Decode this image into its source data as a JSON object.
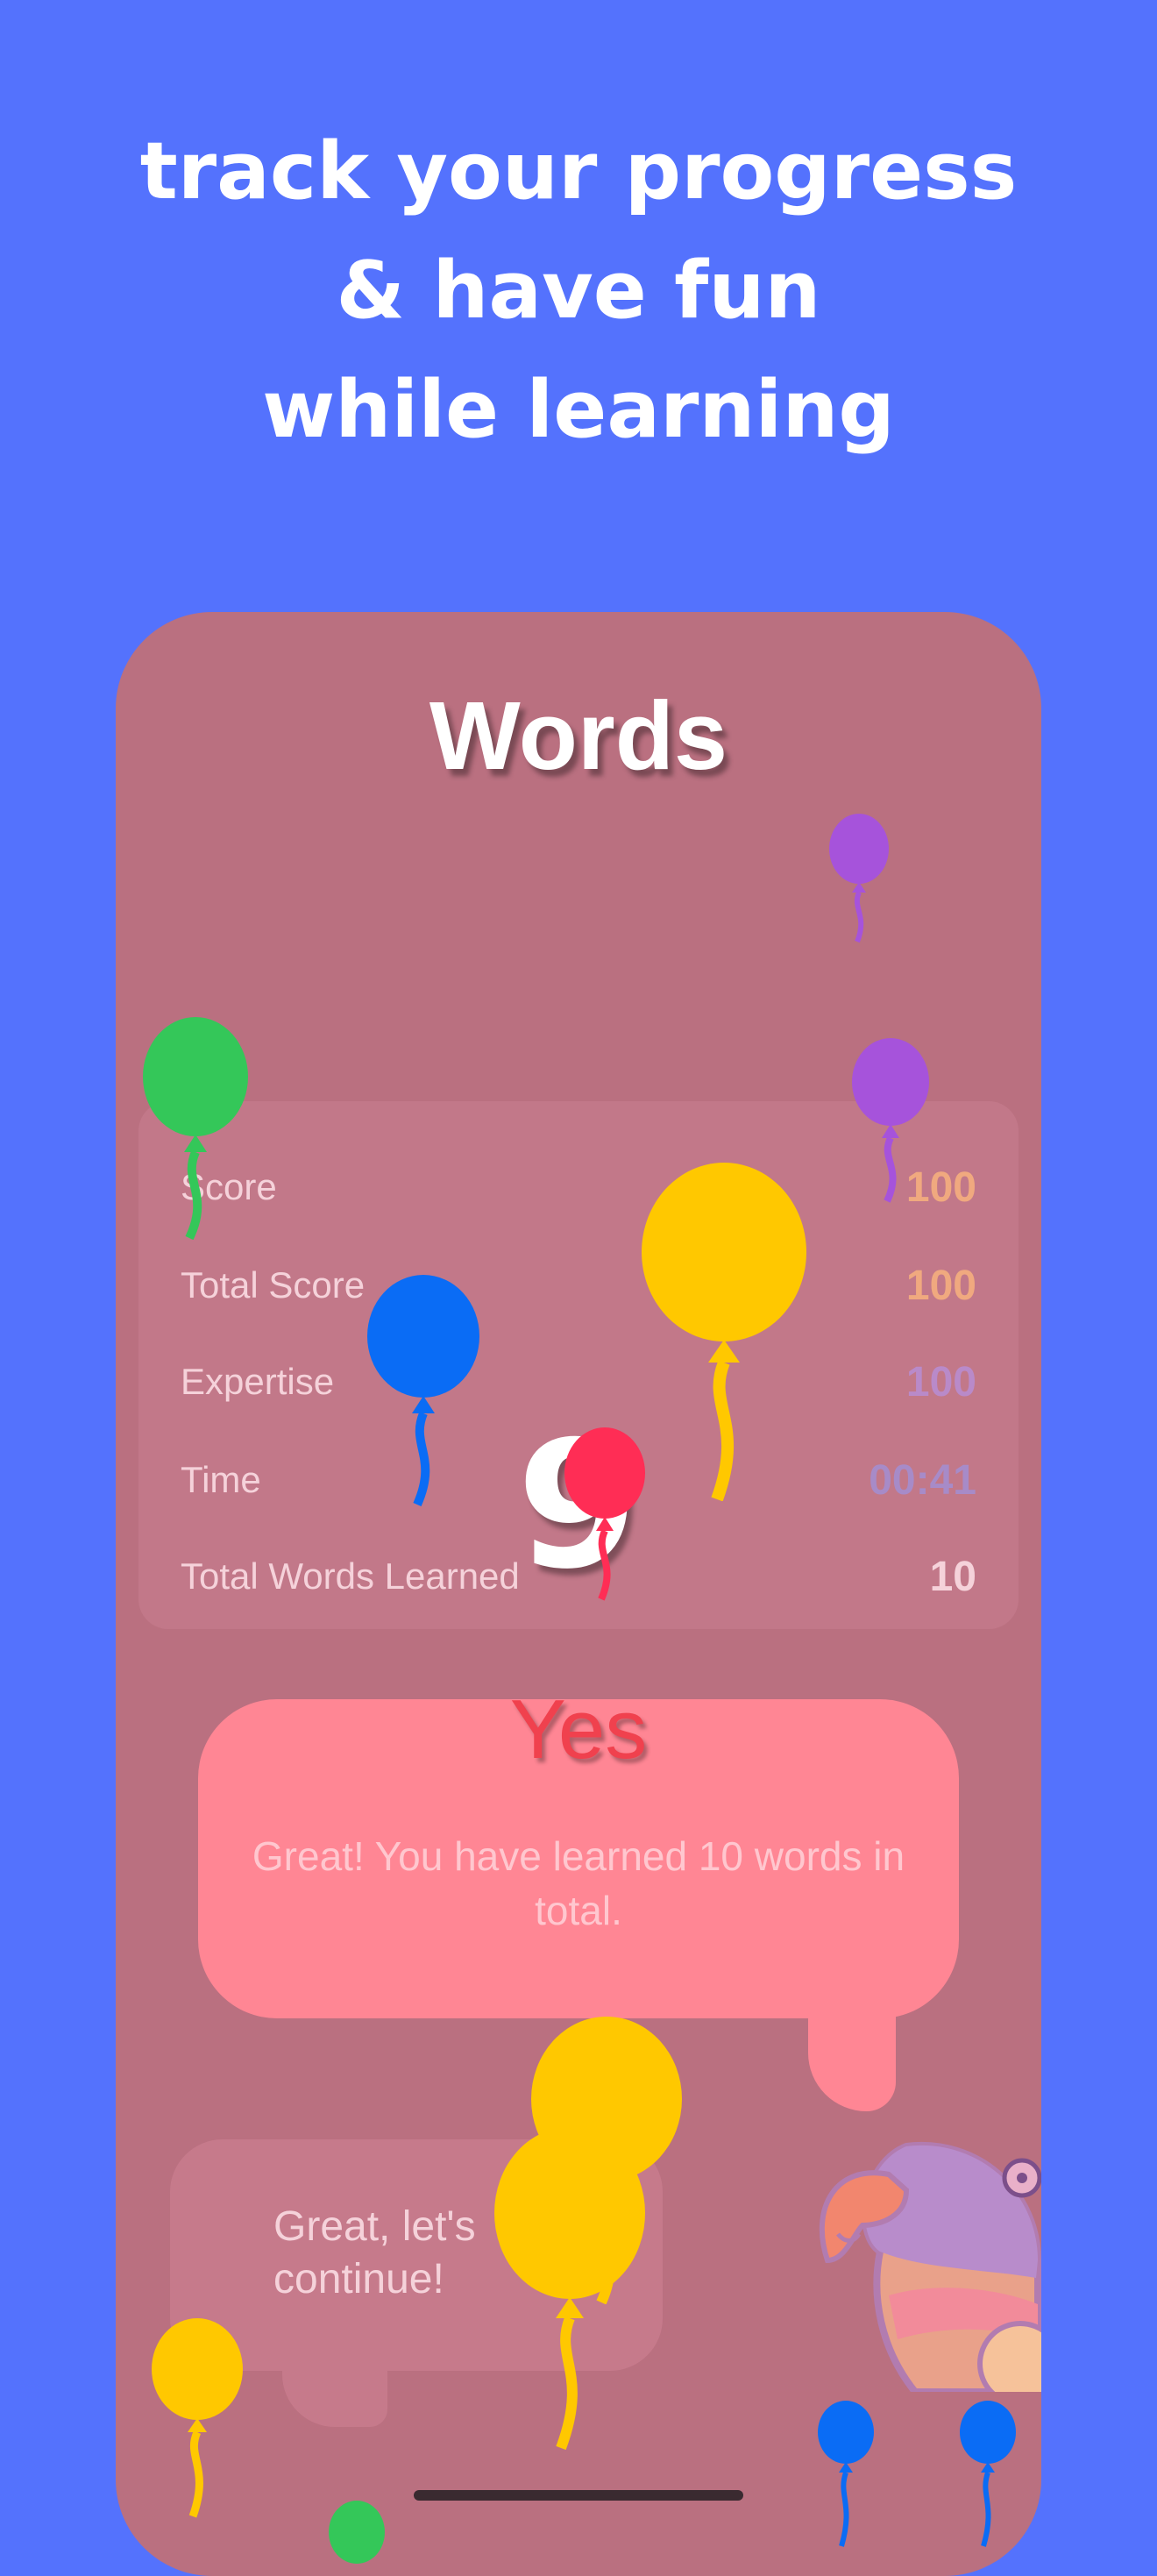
{
  "headline": {
    "line1": "track your progress",
    "line2": "& have fun",
    "line3": "while learning"
  },
  "screen": {
    "title": "Words",
    "stats": [
      {
        "label": "Score",
        "value": "100",
        "color": "#F0A97F"
      },
      {
        "label": "Total Score",
        "value": "100",
        "color": "#F0A97F"
      },
      {
        "label": "Expertise",
        "value": "100",
        "color": "#B98AC9"
      },
      {
        "label": "Time",
        "value": "00:41",
        "color": "#A78BC8"
      },
      {
        "label": "Total Words Learned",
        "value": "10",
        "color": "#F5D2DA"
      }
    ],
    "countdown": "9",
    "feedback": {
      "title": "Yes",
      "message": "Great! You have learned 10 words in total."
    },
    "reply": "Great, let's continue!"
  },
  "colors": {
    "background": "#5472FD",
    "phone": "#BA7080",
    "balloon_yellow": "#FFC800",
    "balloon_blue": "#0A6CF5",
    "balloon_green": "#34C759",
    "balloon_purple": "#A653DB",
    "balloon_red": "#FF2D55"
  },
  "icons": [
    "balloon-icon",
    "parrot-mascot-icon"
  ]
}
